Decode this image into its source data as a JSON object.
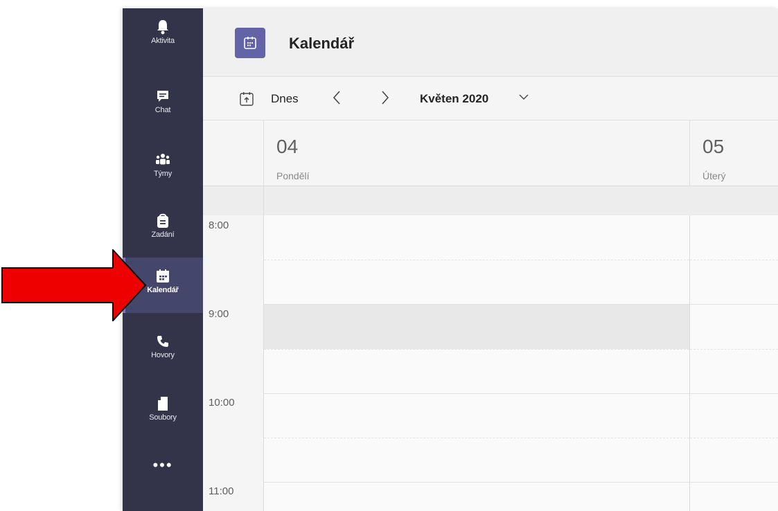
{
  "rail": {
    "items": [
      {
        "label": "Aktivita",
        "icon": "bell-icon"
      },
      {
        "label": "Chat",
        "icon": "chat-icon"
      },
      {
        "label": "Týmy",
        "icon": "teams-icon"
      },
      {
        "label": "Zadání",
        "icon": "assignments-icon"
      },
      {
        "label": "Kalendář",
        "icon": "calendar-icon",
        "active": true
      },
      {
        "label": "Hovory",
        "icon": "phone-icon"
      },
      {
        "label": "Soubory",
        "icon": "files-icon"
      }
    ],
    "more_label": "•••"
  },
  "header": {
    "title": "Kalendář",
    "icon": "calendar-icon"
  },
  "toolbar": {
    "today_label": "Dnes",
    "prev_label": "〈",
    "next_label": "〉",
    "month_label": "Květen 2020"
  },
  "days": [
    {
      "number": "04",
      "name": "Pondělí"
    },
    {
      "number": "05",
      "name": "Úterý"
    }
  ],
  "times": [
    "8:00",
    "9:00",
    "10:00",
    "11:00"
  ],
  "colors": {
    "rail_bg": "#33344a",
    "accent": "#6264a7",
    "arrow": "#ee0000"
  }
}
